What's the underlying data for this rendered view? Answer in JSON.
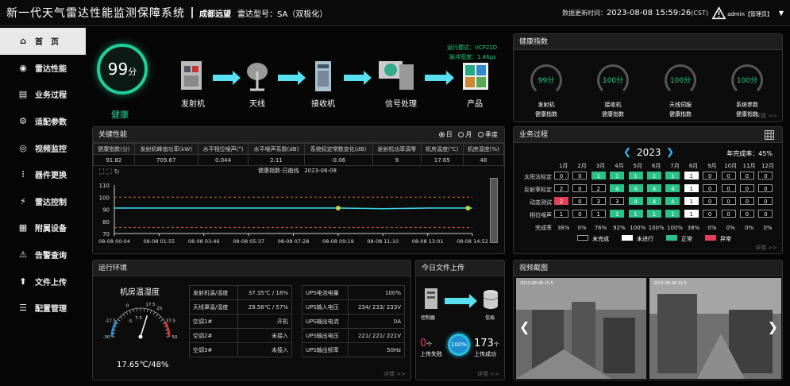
{
  "header": {
    "title": "新一代天气雷达性能监测保障系统",
    "site": "成都远望",
    "radar_label": "雷达型号：SA（双极化）",
    "update_label": "数据更新时间：",
    "update_time": "2023-08-08 15:59:26",
    "update_tz": "(CST)",
    "user": "admin【管理员】"
  },
  "sidebar": {
    "items": [
      {
        "label": "首　页",
        "icon": "home-icon"
      },
      {
        "label": "雷达性能",
        "icon": "radar-icon"
      },
      {
        "label": "业务过程",
        "icon": "process-icon"
      },
      {
        "label": "适配参数",
        "icon": "params-icon"
      },
      {
        "label": "视频监控",
        "icon": "camera-icon"
      },
      {
        "label": "器件更换",
        "icon": "parts-icon"
      },
      {
        "label": "雷达控制",
        "icon": "control-icon"
      },
      {
        "label": "附属设备",
        "icon": "device-icon"
      },
      {
        "label": "告警查询",
        "icon": "alarm-icon"
      },
      {
        "label": "文件上传",
        "icon": "upload-icon"
      },
      {
        "label": "配置管理",
        "icon": "config-icon"
      }
    ]
  },
  "overview": {
    "score": "99",
    "score_unit": "分",
    "health_label": "健康",
    "mode": "运行模式：VCP21D",
    "pulse": "脉冲宽度：1.46μs",
    "flow": [
      "发射机",
      "天线",
      "接收机",
      "信号处理",
      "产品"
    ]
  },
  "health_panel": {
    "title": "健康指数",
    "items": [
      {
        "value": "99分",
        "name": "发射机",
        "sub": "健康指数"
      },
      {
        "value": "100分",
        "name": "接收机",
        "sub": "健康指数"
      },
      {
        "value": "100分",
        "name": "天线伺服",
        "sub": "健康指数"
      },
      {
        "value": "100分",
        "name": "系统参数",
        "sub": "健康指数"
      }
    ],
    "more": "详情 >>"
  },
  "kpi": {
    "title": "关键性能",
    "periods": [
      "日",
      "月",
      "季度"
    ],
    "headers": [
      "健康指数(分)",
      "发射机峰值功率(kW)",
      "水平相位噪声(°)",
      "水平噪声系数(dB)",
      "系统标定常数变化(dB)",
      "发射机功率调零",
      "机房温度(℃)",
      "机房湿度(%)"
    ],
    "values": [
      "91.82",
      "709.67",
      "0.044",
      "2.11",
      "-0.06",
      "9",
      "17.65",
      "48"
    ],
    "chart_caption": "健康指数-日曲线",
    "chart_date": "2023-08-08"
  },
  "chart_data": {
    "type": "line",
    "title": "健康指数-日曲线",
    "x": [
      "08-08 00:04",
      "08-08 01:55",
      "08-08 03:46",
      "08-08 05:37",
      "08-08 07:28",
      "08-08 09:19",
      "08-08 11:10",
      "08-08 13:01",
      "08-08 14:52"
    ],
    "ylim": [
      70,
      110
    ],
    "yticks": [
      "110",
      "100",
      "90",
      "80",
      "70"
    ],
    "series": [
      {
        "values": [
          91,
          91,
          91,
          91,
          91,
          91,
          90.5,
          91,
          91
        ]
      }
    ],
    "thresholds": [
      100,
      75
    ],
    "markers": [
      91,
      91
    ]
  },
  "business": {
    "title": "业务过程",
    "year": "2023",
    "rate_label": "年完成率：45%",
    "months": [
      "1月",
      "2月",
      "3月",
      "4月",
      "5月",
      "6月",
      "7月",
      "8月",
      "9月",
      "10月",
      "11月",
      "12月"
    ],
    "rows": [
      {
        "name": "太阳法标定",
        "cells": [
          "0",
          "0",
          "1",
          "1",
          "1",
          "1",
          "1",
          "1",
          "0",
          "0",
          "0",
          "0"
        ],
        "types": [
          "d",
          "d",
          "g",
          "g",
          "g",
          "g",
          "g",
          "w",
          "d",
          "d",
          "d",
          "d"
        ]
      },
      {
        "name": "反射率标定",
        "cells": [
          "2",
          "0",
          "2",
          "4",
          "4",
          "4",
          "4",
          "1",
          "0",
          "0",
          "0",
          "0"
        ],
        "types": [
          "d",
          "d",
          "d",
          "g",
          "g",
          "g",
          "g",
          "w",
          "d",
          "d",
          "d",
          "d"
        ]
      },
      {
        "name": "动态测试",
        "cells": [
          "2",
          "0",
          "3",
          "3",
          "4",
          "4",
          "4",
          "1",
          "0",
          "0",
          "0",
          "0"
        ],
        "types": [
          "r",
          "d",
          "d",
          "d",
          "g",
          "g",
          "g",
          "w",
          "d",
          "d",
          "d",
          "d"
        ]
      },
      {
        "name": "相位噪声",
        "cells": [
          "1",
          "0",
          "1",
          "1",
          "1",
          "1",
          "1",
          "1",
          "0",
          "0",
          "0",
          "0"
        ],
        "types": [
          "d",
          "d",
          "d",
          "g",
          "g",
          "g",
          "g",
          "w",
          "d",
          "d",
          "d",
          "d"
        ]
      }
    ],
    "rate_row_label": "完成率",
    "rates": [
      "38%",
      "0%",
      "76%",
      "92%",
      "100%",
      "100%",
      "100%",
      "38%",
      "0%",
      "0%",
      "0%",
      "0%"
    ],
    "legend": [
      "未完成",
      "未进行",
      "正常",
      "异常"
    ],
    "more": "详情 >>"
  },
  "env": {
    "title": "运行环境",
    "subtitle": "机房温湿度",
    "reading": "17.65℃/48%",
    "left": [
      [
        "发射机温/湿度",
        "37.35℃ / 18%"
      ],
      [
        "天线罩温/湿度",
        "29.56℃ / 57%"
      ],
      [
        "空调1#",
        "开机"
      ],
      [
        "空调2#",
        "未接入"
      ],
      [
        "空调3#",
        "未接入"
      ]
    ],
    "right": [
      [
        "UPS电池电量",
        "100%"
      ],
      [
        "UPS输入电压",
        "234/ 233/ 233V"
      ],
      [
        "UPS输出电流",
        "0A"
      ],
      [
        "UPS输出电压",
        "221/ 221/ 221V"
      ],
      [
        "UPS输出频率",
        "50Hz"
      ]
    ],
    "gauge_ticks": [
      "-30",
      "-17.5",
      "0",
      "17.5",
      "7.5",
      "25",
      "37.5",
      "50",
      "-5"
    ],
    "more": "详情 >>"
  },
  "upload": {
    "title": "今日文件上传",
    "from": "控制器",
    "to": "信局",
    "fail": "0",
    "fail_unit": "个",
    "fail_label": "上传失败",
    "pct": "100%",
    "ok": "173",
    "ok_unit": "个",
    "ok_label": "上传成功",
    "more": "详情 >>"
  },
  "video": {
    "title": "视频截图",
    "cam1": "2023-08-08 15:5",
    "cam2": "2023-08-08 15:5"
  },
  "colors": {
    "accent": "#1fcf9a",
    "cyan": "#59e0f0",
    "alarm": "#e0405a"
  }
}
